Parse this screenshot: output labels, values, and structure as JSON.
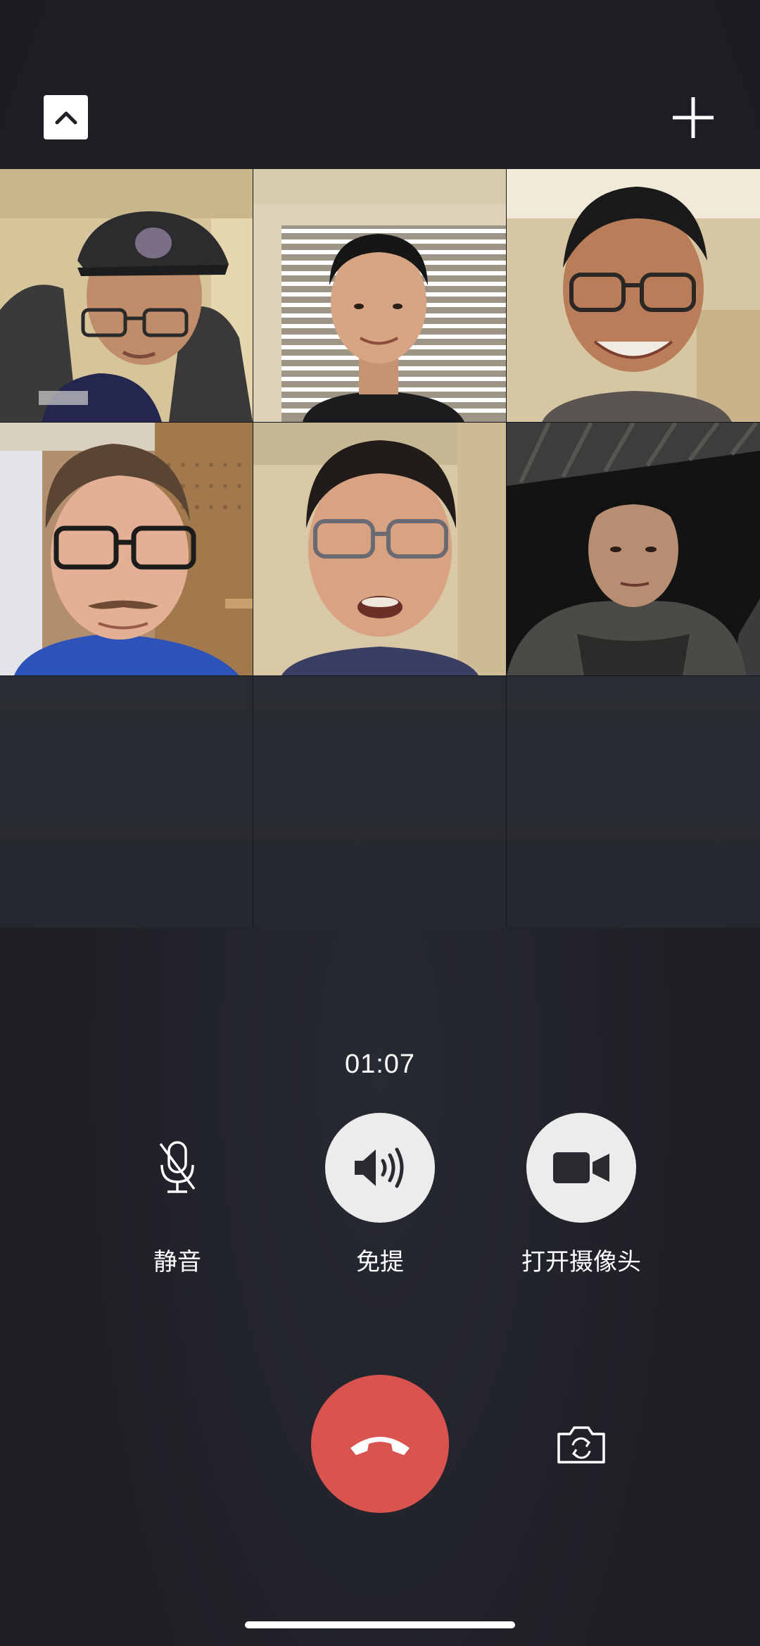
{
  "header": {
    "collapse_icon": "chevron-up-icon",
    "add_icon": "plus-icon"
  },
  "participants": [
    {
      "slot": 1,
      "video": "on",
      "description": "person in cap and glasses"
    },
    {
      "slot": 2,
      "video": "on",
      "description": "person in front of blinds"
    },
    {
      "slot": 3,
      "video": "on",
      "description": "person in glasses smiling"
    },
    {
      "slot": 4,
      "video": "on",
      "description": "person in glasses with mustache"
    },
    {
      "slot": 5,
      "video": "on",
      "description": "person in glasses talking"
    },
    {
      "slot": 6,
      "video": "on",
      "description": "person outdoors at night"
    }
  ],
  "call": {
    "duration": "01:07"
  },
  "controls": {
    "mute": {
      "label": "静音",
      "icon": "microphone-icon",
      "active": false
    },
    "speaker": {
      "label": "免提",
      "icon": "speaker-icon",
      "active": true
    },
    "camera": {
      "label": "打开摄像头",
      "icon": "video-camera-icon",
      "active": true
    },
    "hangup": {
      "icon": "hang-up-icon",
      "color": "#d9534f"
    },
    "flip_camera": {
      "icon": "flip-camera-icon"
    }
  },
  "colors": {
    "background": "#1f2026",
    "hangup": "#d9534f",
    "control_fill": "#ececec"
  }
}
